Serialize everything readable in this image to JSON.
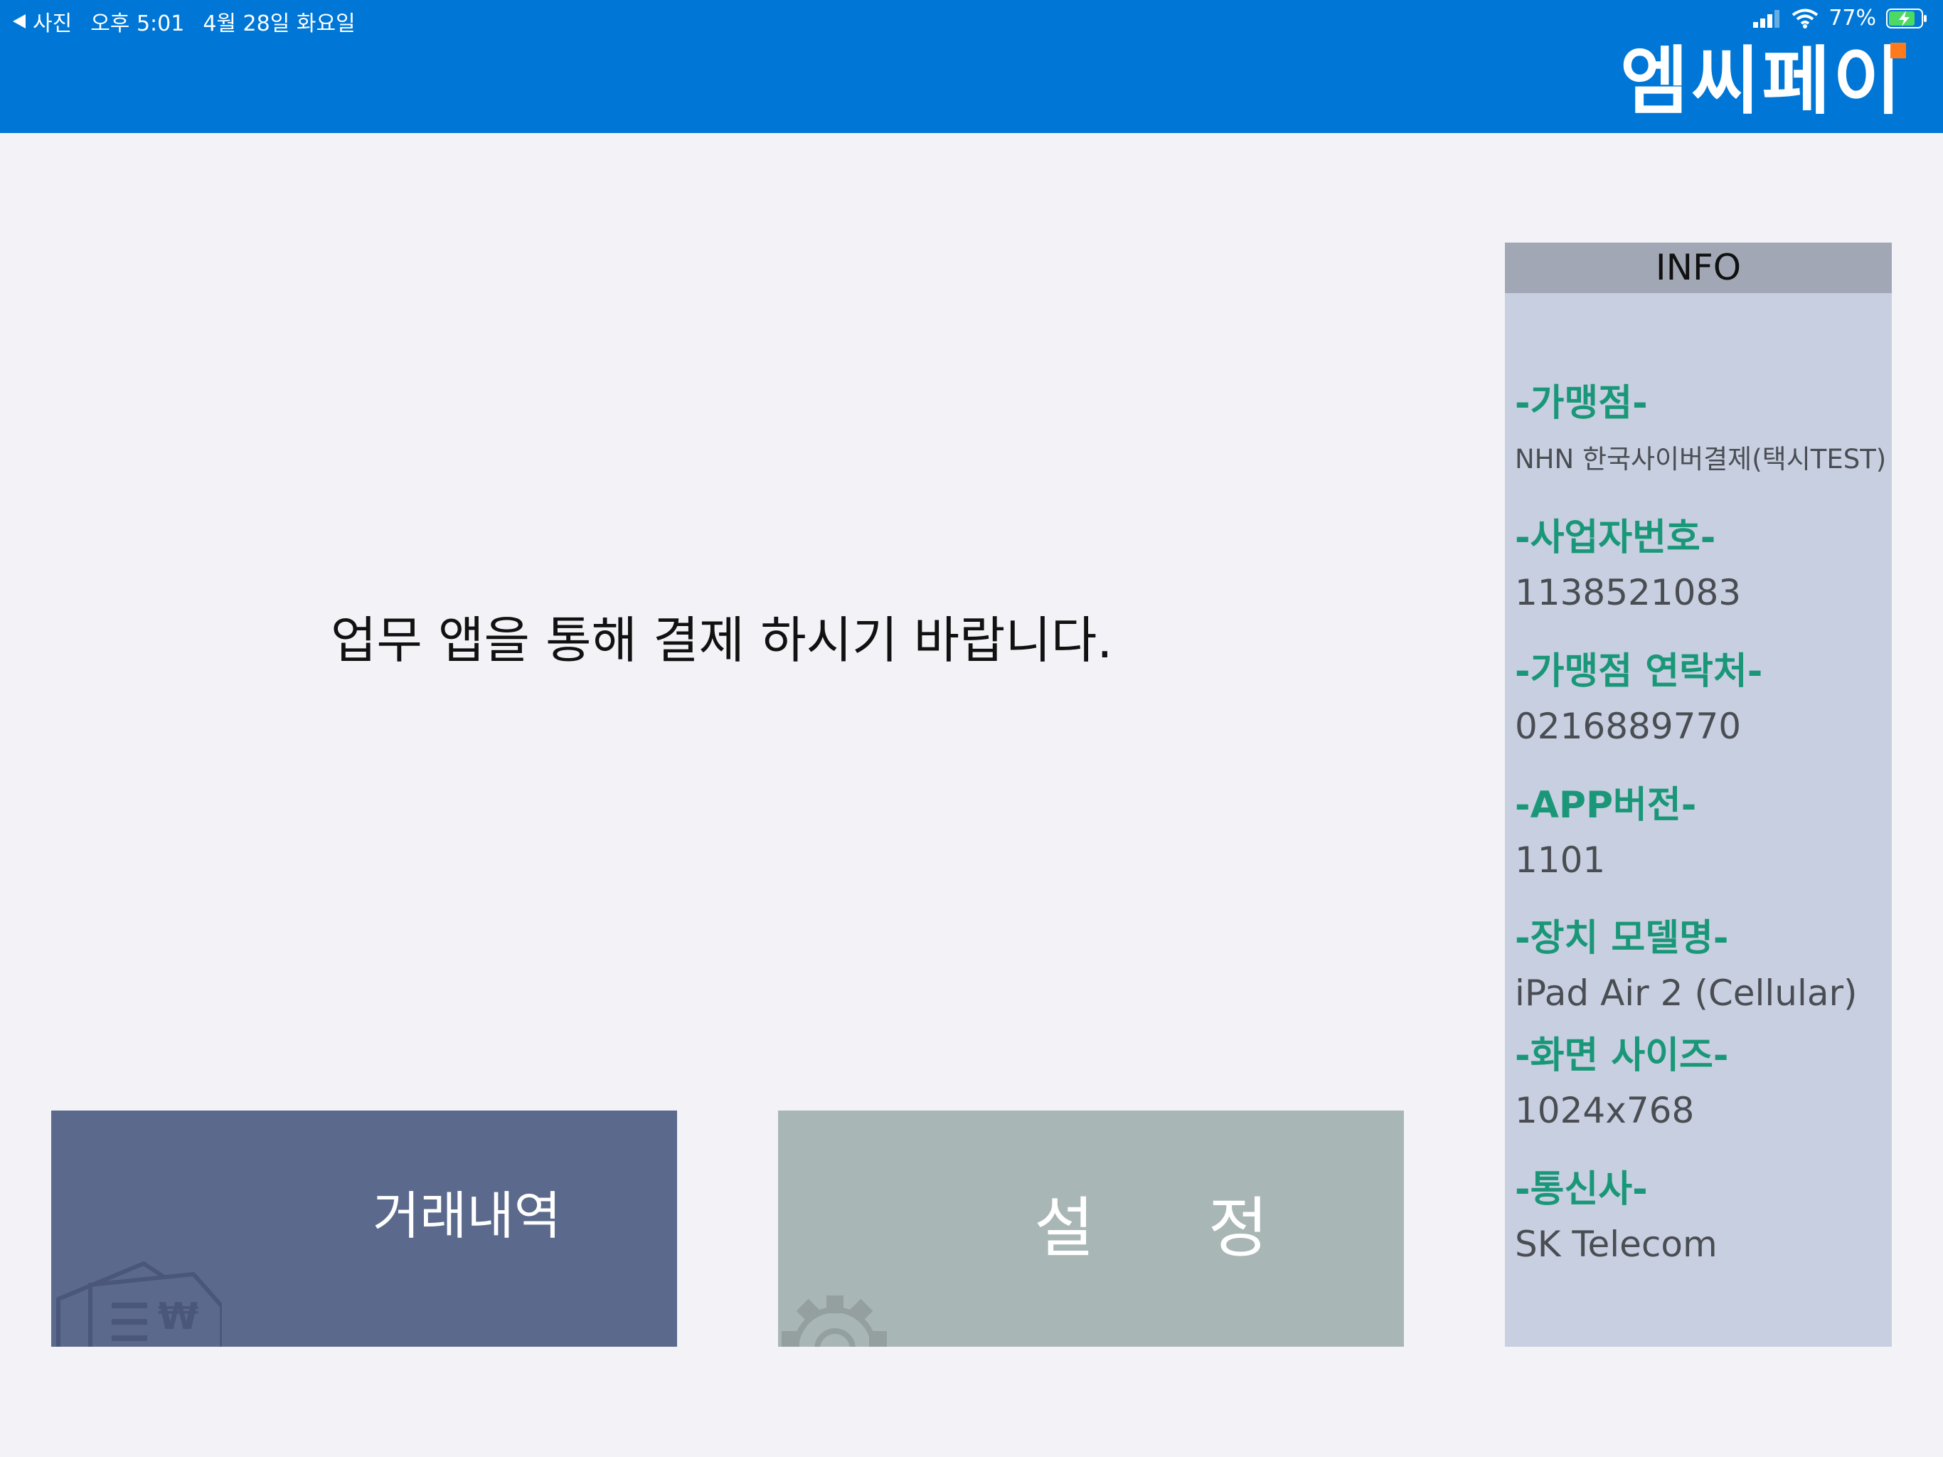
{
  "status_bar": {
    "back_label": "사진",
    "time": "오후 5:01",
    "date": "4월 28일 화요일",
    "battery": "77%"
  },
  "header": {
    "logo": "엠씨페이",
    "color": "#0077d6"
  },
  "main": {
    "message": "업무 앱을 통해 결제 하시기 바랍니다."
  },
  "buttons": {
    "history_label": "거래내역",
    "settings_label": "설정"
  },
  "info": {
    "title": "INFO",
    "items": [
      {
        "label": "-가맹점-",
        "value": "NHN 한국사이버결제(택시TEST)"
      },
      {
        "label": "-사업자번호-",
        "value": "1138521083"
      },
      {
        "label": "-가맹점 연락처-",
        "value": "0216889770"
      },
      {
        "label": "-APP버전-",
        "value": "1101"
      },
      {
        "label": "-장치 모델명-",
        "value": "iPad Air 2 (Cellular)"
      },
      {
        "label": "-화면 사이즈-",
        "value": "1024x768"
      },
      {
        "label": "-통신사-",
        "value": "SK Telecom"
      }
    ]
  },
  "colors": {
    "accent_green": "#1a9778",
    "history_button": "#5b6a8c",
    "settings_button": "#a9b6b6",
    "info_panel": "#c7cfe1"
  }
}
